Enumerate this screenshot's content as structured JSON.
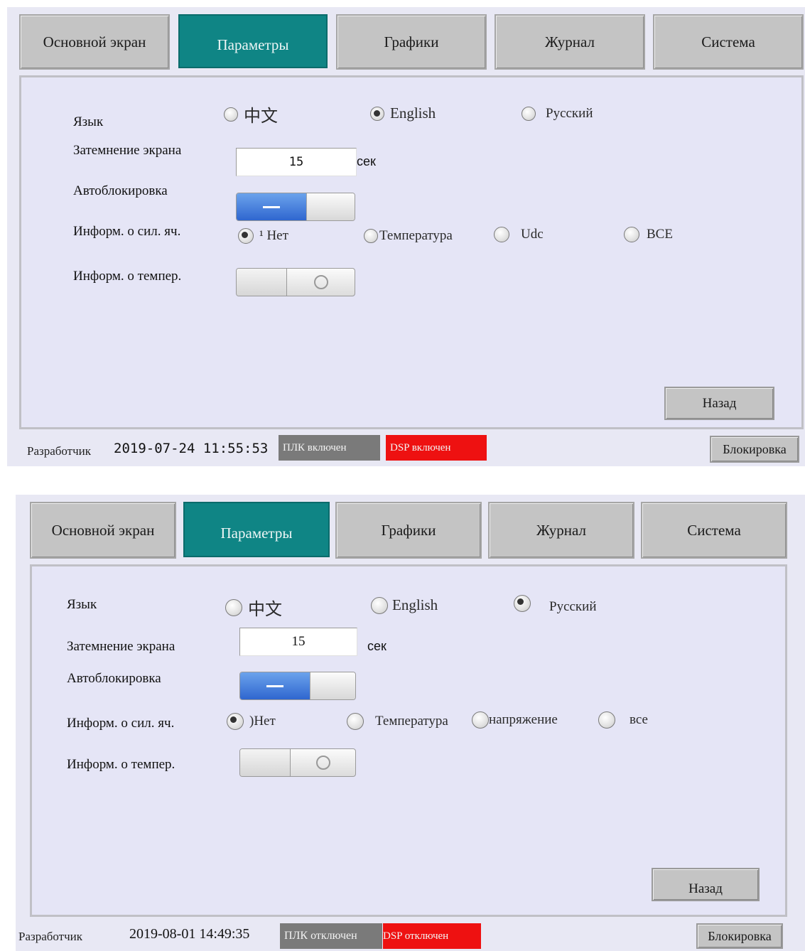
{
  "screens": [
    {
      "tabs": [
        "Основной экран",
        "Параметры",
        "Графики",
        "Журнал",
        "Система"
      ],
      "active_tab": "Параметры",
      "language": {
        "label": "Язык",
        "options": [
          "中文",
          "English",
          "Русский"
        ],
        "selected": "English"
      },
      "dimming": {
        "label": "Затемнение экрана",
        "value": "15",
        "unit": "сек"
      },
      "autolock": {
        "label": "Автоблокировка",
        "state": "on"
      },
      "cell_info": {
        "label": "Информ. о сил. яч.",
        "options": [
          "¹ Нет",
          "Температура",
          "Udc",
          "ВСЕ"
        ],
        "selected": "¹ Нет"
      },
      "temp_info": {
        "label": "Информ. о темпер.",
        "state": "off"
      },
      "back_button": "Назад",
      "status": {
        "user": "Разработчик",
        "datetime": "2019-07-24 11:55:53",
        "plc": "ПЛК включен",
        "dsp": "DSP включен",
        "lock_button": "Блокировка"
      }
    },
    {
      "tabs": [
        "Основной экран",
        "Параметры",
        "Графики",
        "Журнал",
        "Система"
      ],
      "active_tab": "Параметры",
      "language": {
        "label": "Язык",
        "options": [
          "中文",
          "English",
          "Русский"
        ],
        "selected": "Русский"
      },
      "dimming": {
        "label": "Затемнение экрана",
        "value": "15",
        "unit": "сек"
      },
      "autolock": {
        "label": "Автоблокировка",
        "state": "on"
      },
      "cell_info": {
        "label": "Информ. о сил. яч.",
        "options": [
          ")Нет",
          "Температура",
          "напряжение",
          "все"
        ],
        "selected": ")Нет"
      },
      "temp_info": {
        "label": "Информ. о темпер.",
        "state": "off"
      },
      "back_button": "Назад",
      "status": {
        "user": "Разработчик",
        "datetime": "2019-08-01 14:49:35",
        "plc": "ПЛК отключен",
        "dsp": "DSP отключен",
        "lock_button": "Блокировка"
      }
    }
  ],
  "colors": {
    "active_tab": "#0f8585",
    "toggle_on": "#2f66cf",
    "plc_badge": "#7a7a7a",
    "dsp_badge": "#ee1111",
    "screen_bg": "#e8e8f4"
  }
}
